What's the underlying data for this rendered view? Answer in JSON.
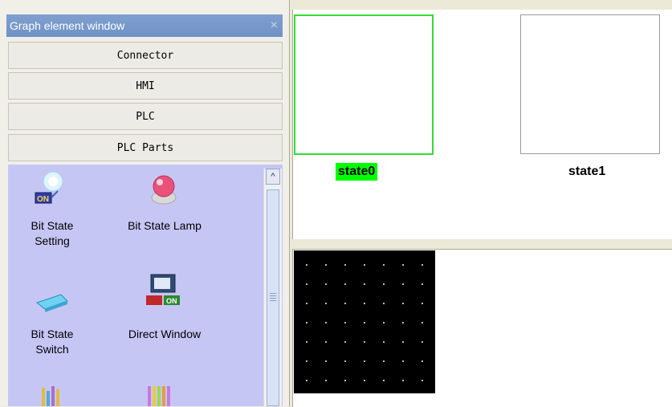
{
  "panel": {
    "title": "Graph element window",
    "close_symbol": "×",
    "categories": [
      "Connector",
      "HMI",
      "PLC",
      "PLC Parts"
    ],
    "items": [
      {
        "label_line1": "Bit State",
        "label_line2": "Setting",
        "icon": "bit-state-setting-icon"
      },
      {
        "label_line1": "Bit State Lamp",
        "label_line2": "",
        "icon": "bit-state-lamp-icon"
      },
      {
        "label_line1": "Bit State",
        "label_line2": "Switch",
        "icon": "bit-state-switch-icon"
      },
      {
        "label_line1": "Direct Window",
        "label_line2": "",
        "icon": "direct-window-icon"
      }
    ],
    "on_text": "ON",
    "scroll_up": "^"
  },
  "canvas": {
    "state0": "state0",
    "state1": "state1"
  },
  "colors": {
    "selection": "#33dd33",
    "items_bg": "#c6c6f5"
  }
}
